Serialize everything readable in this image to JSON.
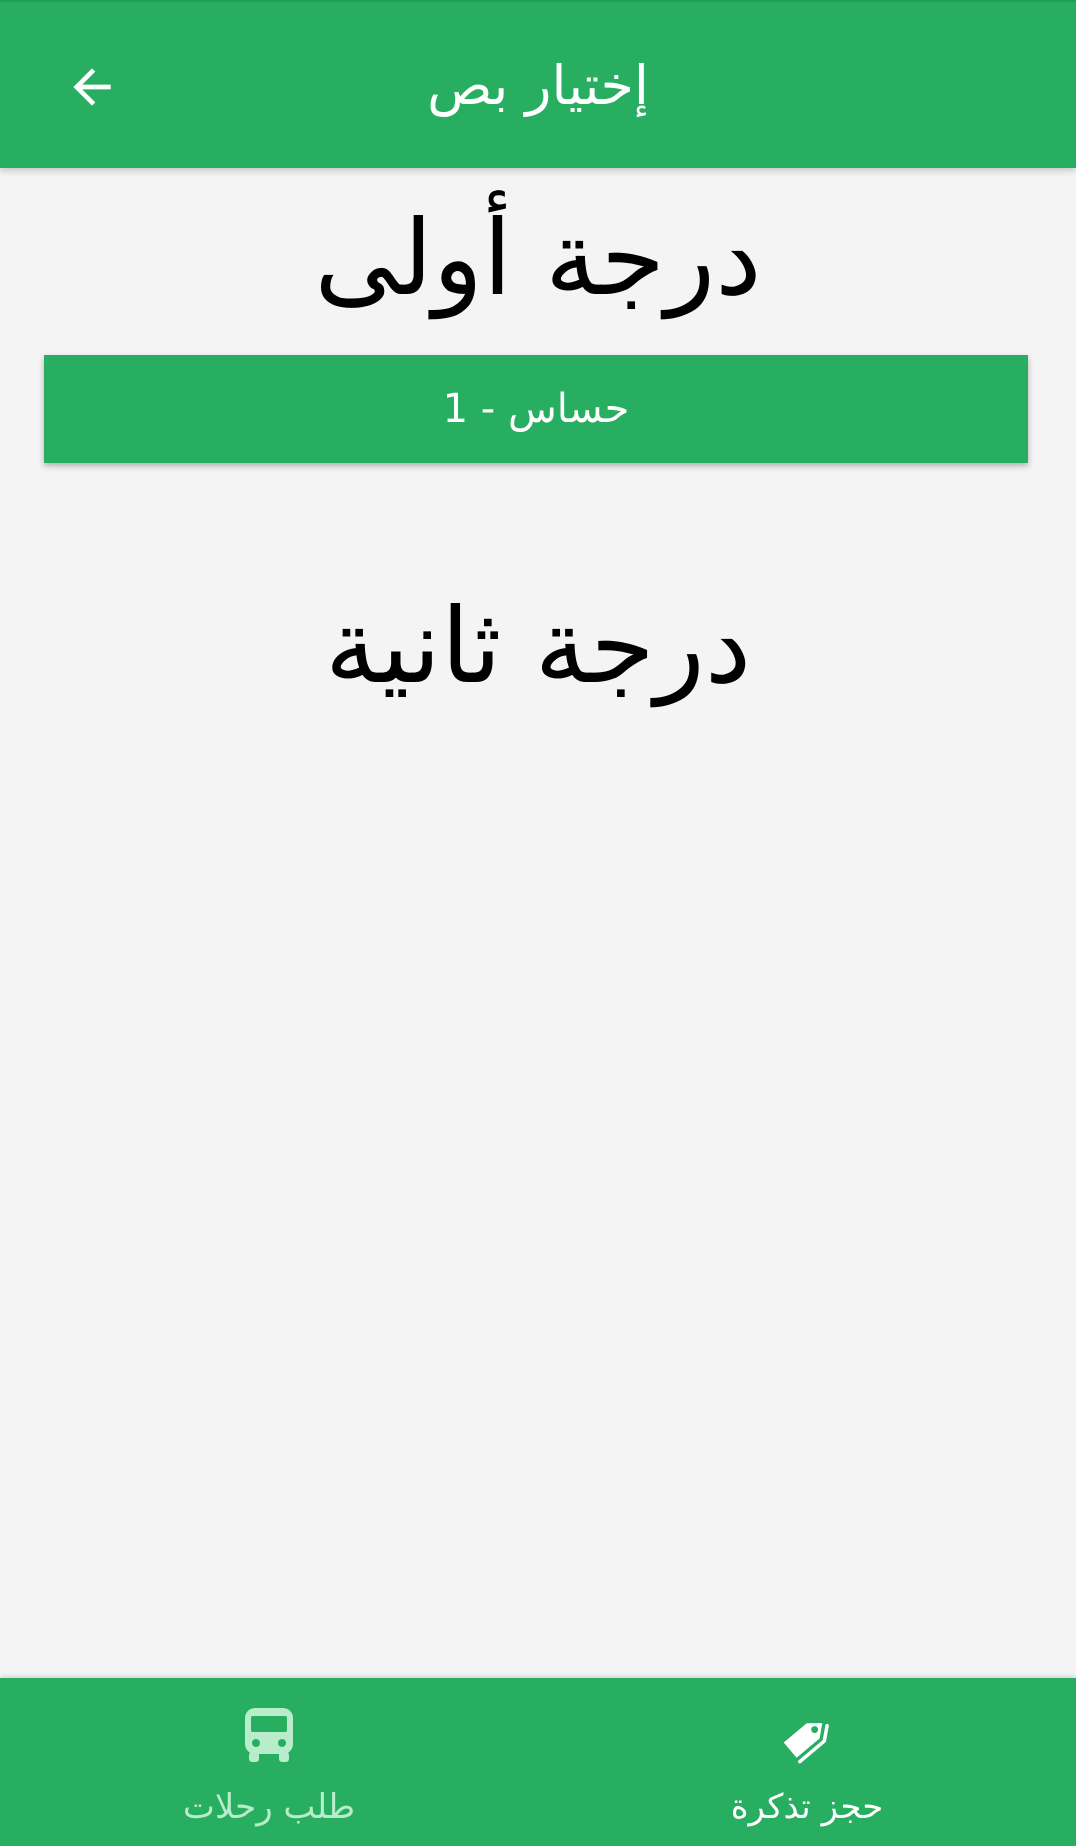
{
  "app_bar": {
    "title": "إختيار بص",
    "back_icon": "arrow-back-icon"
  },
  "sections": {
    "first_class": {
      "title": "درجة أولى",
      "buses": [
        {
          "label": "حساس - 1"
        }
      ]
    },
    "second_class": {
      "title": "درجة ثانية"
    }
  },
  "bottom_nav": {
    "items": [
      {
        "label": "طلب رحلات",
        "icon": "bus-icon",
        "active": false
      },
      {
        "label": "حجز تذكرة",
        "icon": "tags-icon",
        "active": true
      }
    ]
  },
  "colors": {
    "primary": "#27ae60",
    "background": "#f4f4f4",
    "inactive_nav": "#b8ecca"
  }
}
